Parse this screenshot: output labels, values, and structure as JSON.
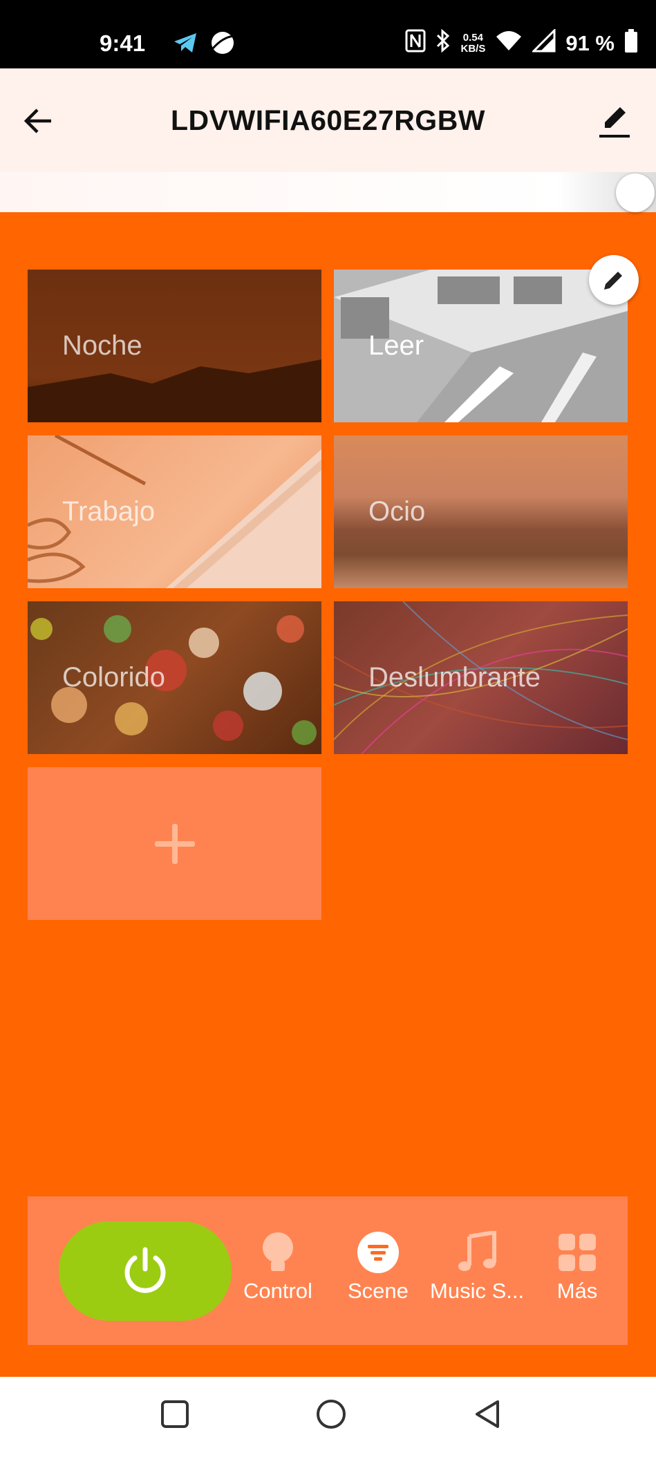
{
  "status_bar": {
    "time": "9:41",
    "net_speed_value": "0.54",
    "net_speed_unit": "KB/S",
    "battery": "91 %"
  },
  "app_bar": {
    "title": "LDVWIFIA60E27RGBW"
  },
  "scenes": [
    {
      "label": "Noche"
    },
    {
      "label": "Leer"
    },
    {
      "label": "Trabajo"
    },
    {
      "label": "Ocio"
    },
    {
      "label": "Colorido"
    },
    {
      "label": "Deslumbrante"
    }
  ],
  "active_scene": "Leer",
  "bottom_nav": {
    "items": [
      {
        "label": "Control",
        "icon": "bulb-icon"
      },
      {
        "label": "Scene",
        "icon": "scene-icon"
      },
      {
        "label": "Music S...",
        "icon": "music-note-icon"
      },
      {
        "label": "Más",
        "icon": "grid-icon"
      }
    ]
  },
  "colors": {
    "background": "#ff6500",
    "power_button": "#9bcc12",
    "tile_overlay": "#ff8350",
    "app_bar": "#fff1ec"
  }
}
